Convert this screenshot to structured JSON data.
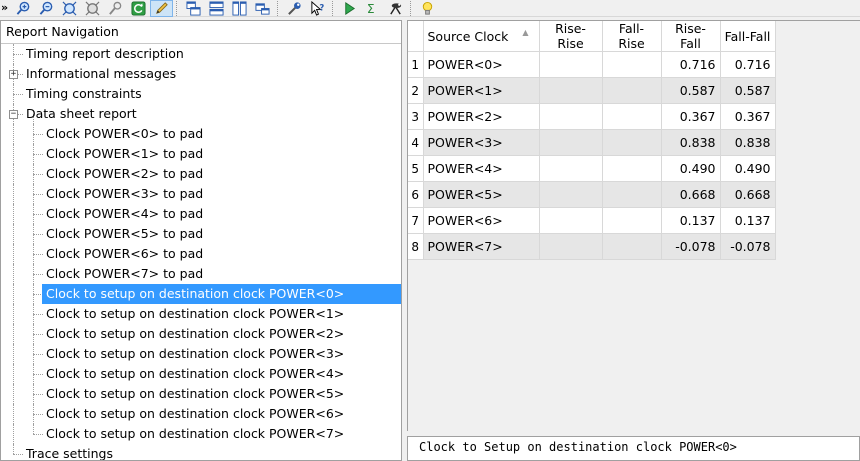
{
  "toolbar": {
    "chevron": "»",
    "icons": [
      "zoom-in-icon",
      "zoom-out-icon",
      "zoom-fit-icon",
      "zoom-full-icon",
      "find-icon",
      "refresh-icon",
      "pencil-icon",
      "cascade-icon",
      "tile-horizontal-icon",
      "tile-vertical-icon",
      "arrange-icon",
      "properties-icon",
      "help-cursor-icon",
      "run-icon",
      "sigma-icon",
      "analyzer-icon",
      "lightbulb-icon"
    ]
  },
  "navigation": {
    "title": "Report Navigation",
    "items": [
      {
        "label": "Timing report description",
        "level": 0
      },
      {
        "label": "Informational messages",
        "level": 0,
        "expander": "+"
      },
      {
        "label": "Timing constraints",
        "level": 0
      },
      {
        "label": "Data sheet report",
        "level": 0,
        "expander": "−"
      },
      {
        "label": "Clock POWER<0> to pad",
        "level": 1
      },
      {
        "label": "Clock POWER<1> to pad",
        "level": 1
      },
      {
        "label": "Clock POWER<2> to pad",
        "level": 1
      },
      {
        "label": "Clock POWER<3> to pad",
        "level": 1
      },
      {
        "label": "Clock POWER<4> to pad",
        "level": 1
      },
      {
        "label": "Clock POWER<5> to pad",
        "level": 1
      },
      {
        "label": "Clock POWER<6> to pad",
        "level": 1
      },
      {
        "label": "Clock POWER<7> to pad",
        "level": 1
      },
      {
        "label": "Clock to setup on destination clock POWER<0>",
        "level": 1,
        "selected": true
      },
      {
        "label": "Clock to setup on destination clock POWER<1>",
        "level": 1
      },
      {
        "label": "Clock to setup on destination clock POWER<2>",
        "level": 1
      },
      {
        "label": "Clock to setup on destination clock POWER<3>",
        "level": 1
      },
      {
        "label": "Clock to setup on destination clock POWER<4>",
        "level": 1
      },
      {
        "label": "Clock to setup on destination clock POWER<5>",
        "level": 1
      },
      {
        "label": "Clock to setup on destination clock POWER<6>",
        "level": 1
      },
      {
        "label": "Clock to setup on destination clock POWER<7>",
        "level": 1
      },
      {
        "label": "Trace settings",
        "level": 0
      }
    ]
  },
  "table": {
    "columns": [
      "Source Clock",
      "Rise-Rise",
      "Fall-Rise",
      "Rise-Fall",
      "Fall-Fall"
    ],
    "rows": [
      {
        "n": "1",
        "source": "POWER<0>",
        "rr": "",
        "fr": "",
        "rf": "0.716",
        "ff": "0.716"
      },
      {
        "n": "2",
        "source": "POWER<1>",
        "rr": "",
        "fr": "",
        "rf": "0.587",
        "ff": "0.587"
      },
      {
        "n": "3",
        "source": "POWER<2>",
        "rr": "",
        "fr": "",
        "rf": "0.367",
        "ff": "0.367"
      },
      {
        "n": "4",
        "source": "POWER<3>",
        "rr": "",
        "fr": "",
        "rf": "0.838",
        "ff": "0.838"
      },
      {
        "n": "5",
        "source": "POWER<4>",
        "rr": "",
        "fr": "",
        "rf": "0.490",
        "ff": "0.490"
      },
      {
        "n": "6",
        "source": "POWER<5>",
        "rr": "",
        "fr": "",
        "rf": "0.668",
        "ff": "0.668"
      },
      {
        "n": "7",
        "source": "POWER<6>",
        "rr": "",
        "fr": "",
        "rf": "0.137",
        "ff": "0.137"
      },
      {
        "n": "8",
        "source": "POWER<7>",
        "rr": "",
        "fr": "",
        "rf": "-0.078",
        "ff": "-0.078"
      }
    ]
  },
  "text_panel": {
    "line": "Clock to Setup on destination clock POWER<0>"
  },
  "colors": {
    "selection": "#3399ff",
    "alt_row": "#e6e6e6"
  }
}
